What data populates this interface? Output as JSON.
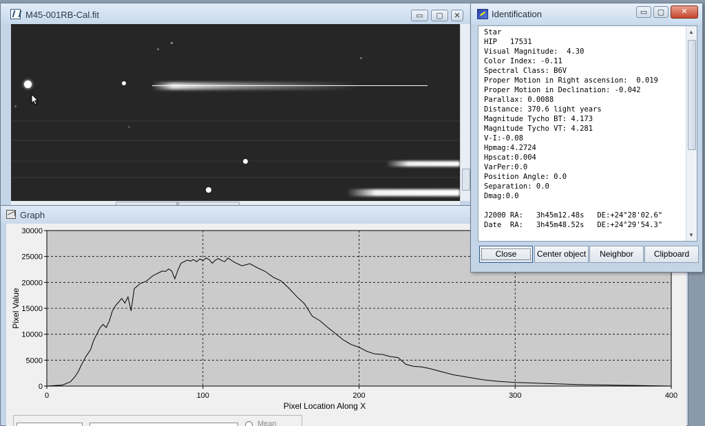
{
  "fit_window": {
    "title": "M45-001RB-Cal.fit",
    "buttons": {
      "minimize": "▭",
      "maximize": "▢",
      "close": "✕"
    }
  },
  "graph_window": {
    "title": "Graph",
    "mean_label": "Mean"
  },
  "identification": {
    "title": "Identification",
    "lines": [
      "Star",
      "HIP   17531",
      "Visual Magnitude:  4.30",
      "Color Index: -0.11",
      "Spectral Class: B6V",
      "Proper Motion in Right ascension:  0.019",
      "Proper Motion in Declination: -0.042",
      "Parallax: 0.0088",
      "Distance: 370.6 light years",
      "Magnitude Tycho BT: 4.173",
      "Magnitude Tycho VT: 4.281",
      "V-I:-0.08",
      "Hpmag:4.2724",
      "Hpscat:0.004",
      "VarPer:0.0",
      "Position Angle: 0.0",
      "Separation: 0.0",
      "Dmag:0.0",
      "",
      "J2000 RA:   3h45m12.48s   DE:+24°28'02.6\"",
      "Date  RA:   3h45m48.52s   DE:+24°29'54.3\""
    ],
    "buttons": {
      "close": "Close",
      "center_object": "Center object",
      "neighbor": "Neighbor",
      "clipboard": "Clipboard"
    }
  },
  "chart_data": {
    "type": "line",
    "title": "",
    "xlabel": "Pixel Location Along X",
    "ylabel": "Pixel Value",
    "xlim": [
      0,
      400
    ],
    "ylim": [
      0,
      30000
    ],
    "xticks": [
      "0",
      "100",
      "200",
      "300",
      "400"
    ],
    "yticks": [
      "0",
      "5000",
      "10000",
      "15000",
      "20000",
      "25000",
      "30000"
    ],
    "grid": true,
    "x": [
      0,
      10,
      15,
      18,
      20,
      22,
      25,
      28,
      30,
      32,
      34,
      36,
      38,
      40,
      42,
      44,
      46,
      48,
      50,
      52,
      54,
      56,
      58,
      60,
      62,
      64,
      66,
      68,
      70,
      72,
      74,
      76,
      78,
      80,
      82,
      84,
      86,
      88,
      90,
      92,
      94,
      96,
      98,
      100,
      102,
      104,
      106,
      108,
      110,
      112,
      114,
      116,
      118,
      120,
      125,
      130,
      135,
      140,
      145,
      150,
      155,
      160,
      165,
      170,
      175,
      180,
      185,
      190,
      195,
      200,
      205,
      210,
      215,
      220,
      225,
      230,
      235,
      240,
      245,
      250,
      255,
      260,
      270,
      280,
      290,
      300,
      320,
      340,
      360,
      380,
      400
    ],
    "values": [
      0,
      200,
      800,
      1800,
      2700,
      4000,
      5700,
      7000,
      8800,
      10000,
      11200,
      11900,
      11300,
      12500,
      14500,
      15500,
      16200,
      16900,
      16000,
      17200,
      14500,
      18800,
      19300,
      19800,
      20000,
      20300,
      20800,
      21300,
      21600,
      21900,
      22200,
      22100,
      22600,
      22200,
      20700,
      22400,
      23700,
      24000,
      24300,
      24100,
      24400,
      24000,
      24500,
      24200,
      24700,
      24400,
      23700,
      24300,
      24600,
      24200,
      24000,
      24700,
      24300,
      23900,
      23200,
      23600,
      22800,
      22100,
      21000,
      20300,
      18900,
      17300,
      15900,
      13500,
      12600,
      11300,
      10100,
      8900,
      8000,
      7500,
      6700,
      6200,
      6100,
      5700,
      5500,
      4200,
      3800,
      3700,
      3400,
      3000,
      2600,
      2200,
      1700,
      1200,
      900,
      700,
      500,
      300,
      200,
      100,
      0
    ]
  },
  "colors": {
    "plot_bg": "#cbcbcb",
    "line": "#000000",
    "sky_bg": "#262626"
  }
}
